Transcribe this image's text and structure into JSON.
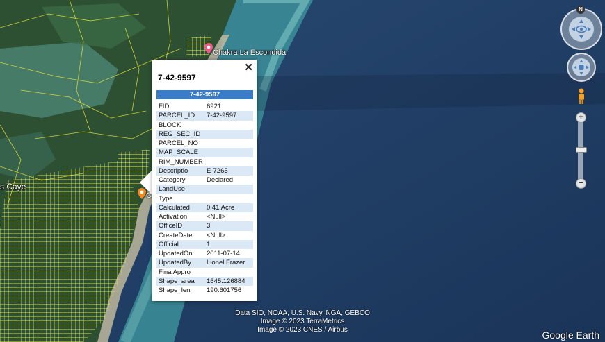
{
  "map": {
    "place_labels": [
      "Chakra La Escondida",
      "s Caye",
      "C"
    ]
  },
  "popup": {
    "title": "7-42-9597",
    "header": "7-42-9597",
    "close_glyph": "✕",
    "rows": [
      {
        "key": "FID",
        "value": "6921"
      },
      {
        "key": "PARCEL_ID",
        "value": "7-42-9597"
      },
      {
        "key": "BLOCK",
        "value": ""
      },
      {
        "key": "REG_SEC_ID",
        "value": ""
      },
      {
        "key": "PARCEL_NO",
        "value": ""
      },
      {
        "key": "MAP_SCALE",
        "value": ""
      },
      {
        "key": "RIM_NUMBER",
        "value": ""
      },
      {
        "key": "Descriptio",
        "value": "E-7265"
      },
      {
        "key": "Category",
        "value": "Declared"
      },
      {
        "key": "LandUse",
        "value": ""
      },
      {
        "key": "Type",
        "value": ""
      },
      {
        "key": "Calculated",
        "value": "0.41 Acre"
      },
      {
        "key": "Activation",
        "value": "<Null>"
      },
      {
        "key": "OfficeID",
        "value": "3"
      },
      {
        "key": "CreateDate",
        "value": "<Null>"
      },
      {
        "key": "Official",
        "value": "1"
      },
      {
        "key": "UpdatedOn",
        "value": "2011-07-14"
      },
      {
        "key": "UpdatedBy",
        "value": "Lionel Frazer"
      },
      {
        "key": "FinalAppro",
        "value": ""
      },
      {
        "key": "Shape_area",
        "value": "1645.126884"
      },
      {
        "key": "Shape_len",
        "value": "190.601756"
      }
    ]
  },
  "credits": [
    "Data SIO, NOAA, U.S. Navy, NGA, GEBCO",
    "Image © 2023 TerraMetrics",
    "Image © 2023 CNES / Airbus"
  ],
  "brand": "Google Earth",
  "nav": {
    "north_label": "N",
    "zoom_in": "+",
    "zoom_out": "−"
  },
  "colors": {
    "ocean": "#1f3d63",
    "parcel_lines": "#e8e83a",
    "header_blue": "#3a7cc5",
    "row_stripe": "#dbe8f5"
  }
}
